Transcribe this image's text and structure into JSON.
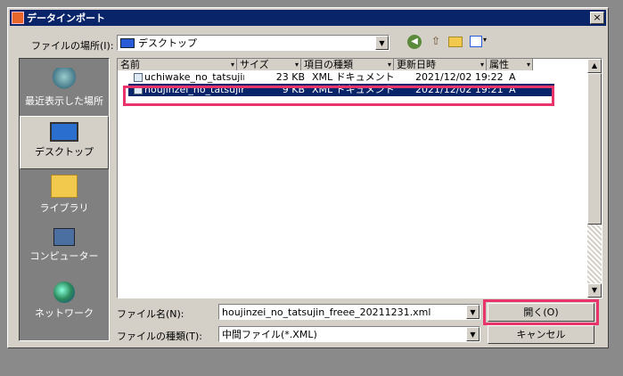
{
  "window": {
    "title": "データインポート",
    "close_label": "×"
  },
  "lookin": {
    "label": "ファイルの場所(I):",
    "value": "デスクトップ"
  },
  "toolbar": {
    "icons": [
      "back-icon",
      "up-folder-icon",
      "new-folder-icon",
      "view-menu-icon"
    ]
  },
  "places": [
    {
      "label": "最近表示した場所",
      "icon": "recent-places-icon"
    },
    {
      "label": "デスクトップ",
      "icon": "desktop-icon"
    },
    {
      "label": "ライブラリ",
      "icon": "libraries-icon"
    },
    {
      "label": "コンピューター",
      "icon": "computer-icon"
    },
    {
      "label": "ネットワーク",
      "icon": "network-icon"
    }
  ],
  "columns": [
    "名前",
    "サイズ",
    "項目の種類",
    "更新日時",
    "属性"
  ],
  "files": [
    {
      "name": "uchiwake_no_tatsujin...",
      "size": "23 KB",
      "type": "XML ドキュメント",
      "modified": "2021/12/02 19:22",
      "attr": "A"
    },
    {
      "name": "houjinzei_no_tatsujin_...",
      "size": "9 KB",
      "type": "XML ドキュメント",
      "modified": "2021/12/02 19:21",
      "attr": "A"
    }
  ],
  "filename": {
    "label": "ファイル名(N):",
    "value": "houjinzei_no_tatsujin_freee_20211231.xml"
  },
  "filetype": {
    "label": "ファイルの種類(T):",
    "value": "中間ファイル(*.XML)"
  },
  "buttons": {
    "open": "開く(O)",
    "cancel": "キャンセル"
  },
  "colors": {
    "highlight": "#e8336b",
    "selection": "#0a246a"
  }
}
